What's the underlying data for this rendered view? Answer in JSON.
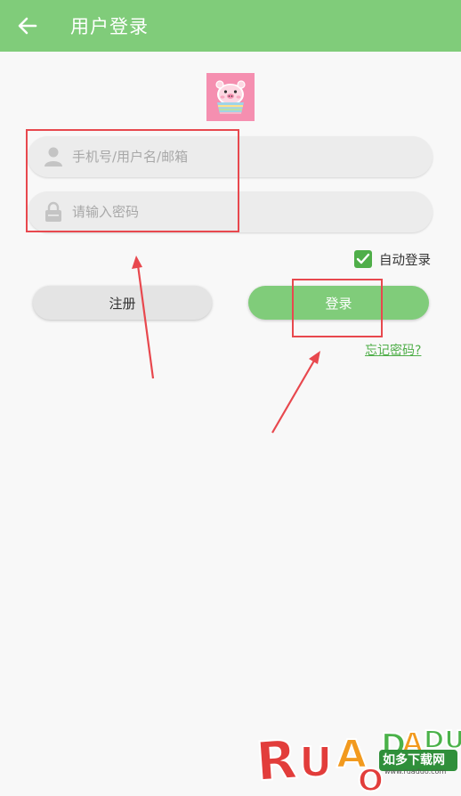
{
  "header": {
    "title": "用户登录",
    "back_icon": "arrow-left-icon",
    "background": "#80cc7a"
  },
  "avatar": {
    "icon": "pig-in-cup-icon",
    "background": "#f58fb0"
  },
  "form": {
    "username": {
      "placeholder": "手机号/用户名/邮箱",
      "value": "",
      "icon": "user-icon"
    },
    "password": {
      "placeholder": "请输入密码",
      "value": "",
      "icon": "lock-icon"
    },
    "auto_login": {
      "label": "自动登录",
      "checked": true
    },
    "register_label": "注册",
    "login_label": "登录",
    "forgot_label": "忘记密码?"
  },
  "watermark": {
    "logo_text": "RUAODADUO",
    "chinese": "如多下载网",
    "url": "www.ruaduo.com"
  },
  "colors": {
    "accent": "#80cc7a",
    "link": "#4fae49",
    "annotation": "#e8484e"
  }
}
